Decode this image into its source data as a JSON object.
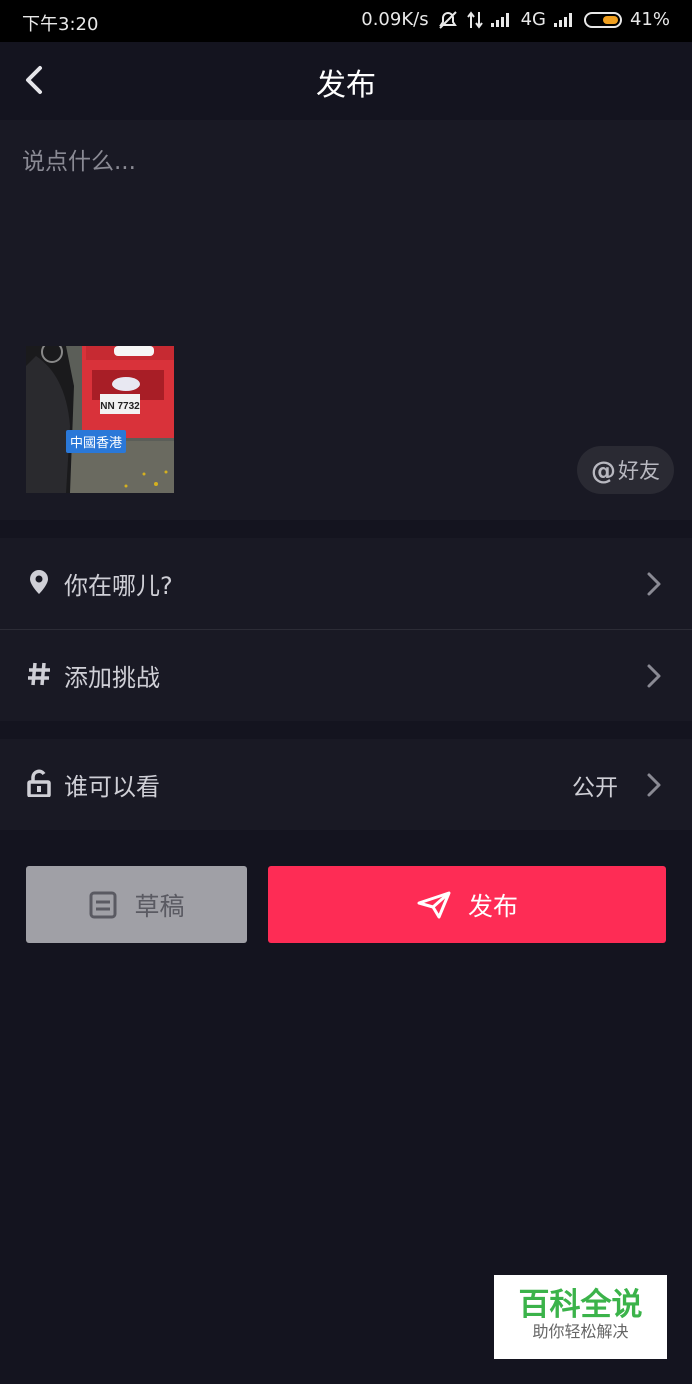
{
  "status_bar": {
    "time": "下午3:20",
    "network_speed": "0.09K/s",
    "network_type": "4G",
    "battery": "41%"
  },
  "header": {
    "title": "发布"
  },
  "compose": {
    "placeholder": "说点什么...",
    "thumbnail_caption": "中國香港",
    "plate": "NN 7732",
    "mention_label": "好友"
  },
  "options": {
    "location_label": "你在哪儿?",
    "challenge_label": "添加挑战",
    "visibility_label": "谁可以看",
    "visibility_value": "公开"
  },
  "actions": {
    "draft_label": "草稿",
    "publish_label": "发布"
  },
  "watermark": {
    "title": "百科全说",
    "subtitle": "助你轻松解决"
  },
  "colors": {
    "background": "#14141f",
    "panel": "#191924",
    "publish": "#fe2c55",
    "draft": "#a0a0a6",
    "watermark_green": "#3bb34a"
  }
}
